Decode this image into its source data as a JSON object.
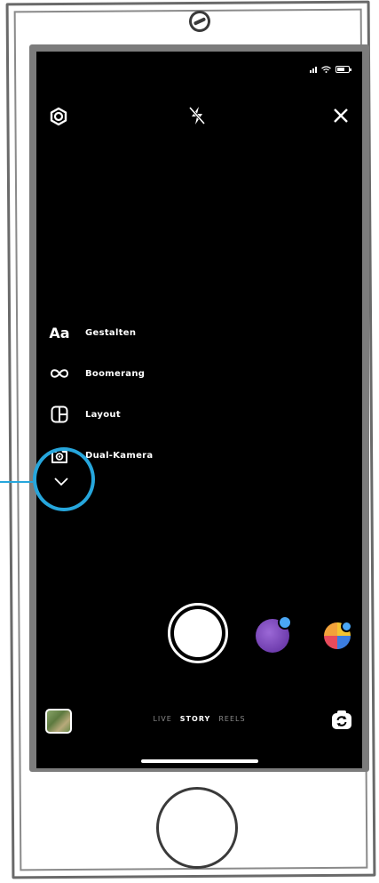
{
  "creation_tools": [
    {
      "icon": "aa-text-icon",
      "icon_text": "Aa",
      "label": "Gestalten"
    },
    {
      "icon": "infinity-icon",
      "label": "Boomerang"
    },
    {
      "icon": "layout-icon",
      "label": "Layout"
    },
    {
      "icon": "dual-camera-icon",
      "label": "Dual-Kamera"
    }
  ],
  "modes": {
    "live": "LIVE",
    "story": "STORY",
    "reels": "REELS",
    "active": "STORY"
  },
  "colors": {
    "highlight": "#26a6dc",
    "background": "#000000",
    "effect_badge": "#4aa7f5"
  }
}
